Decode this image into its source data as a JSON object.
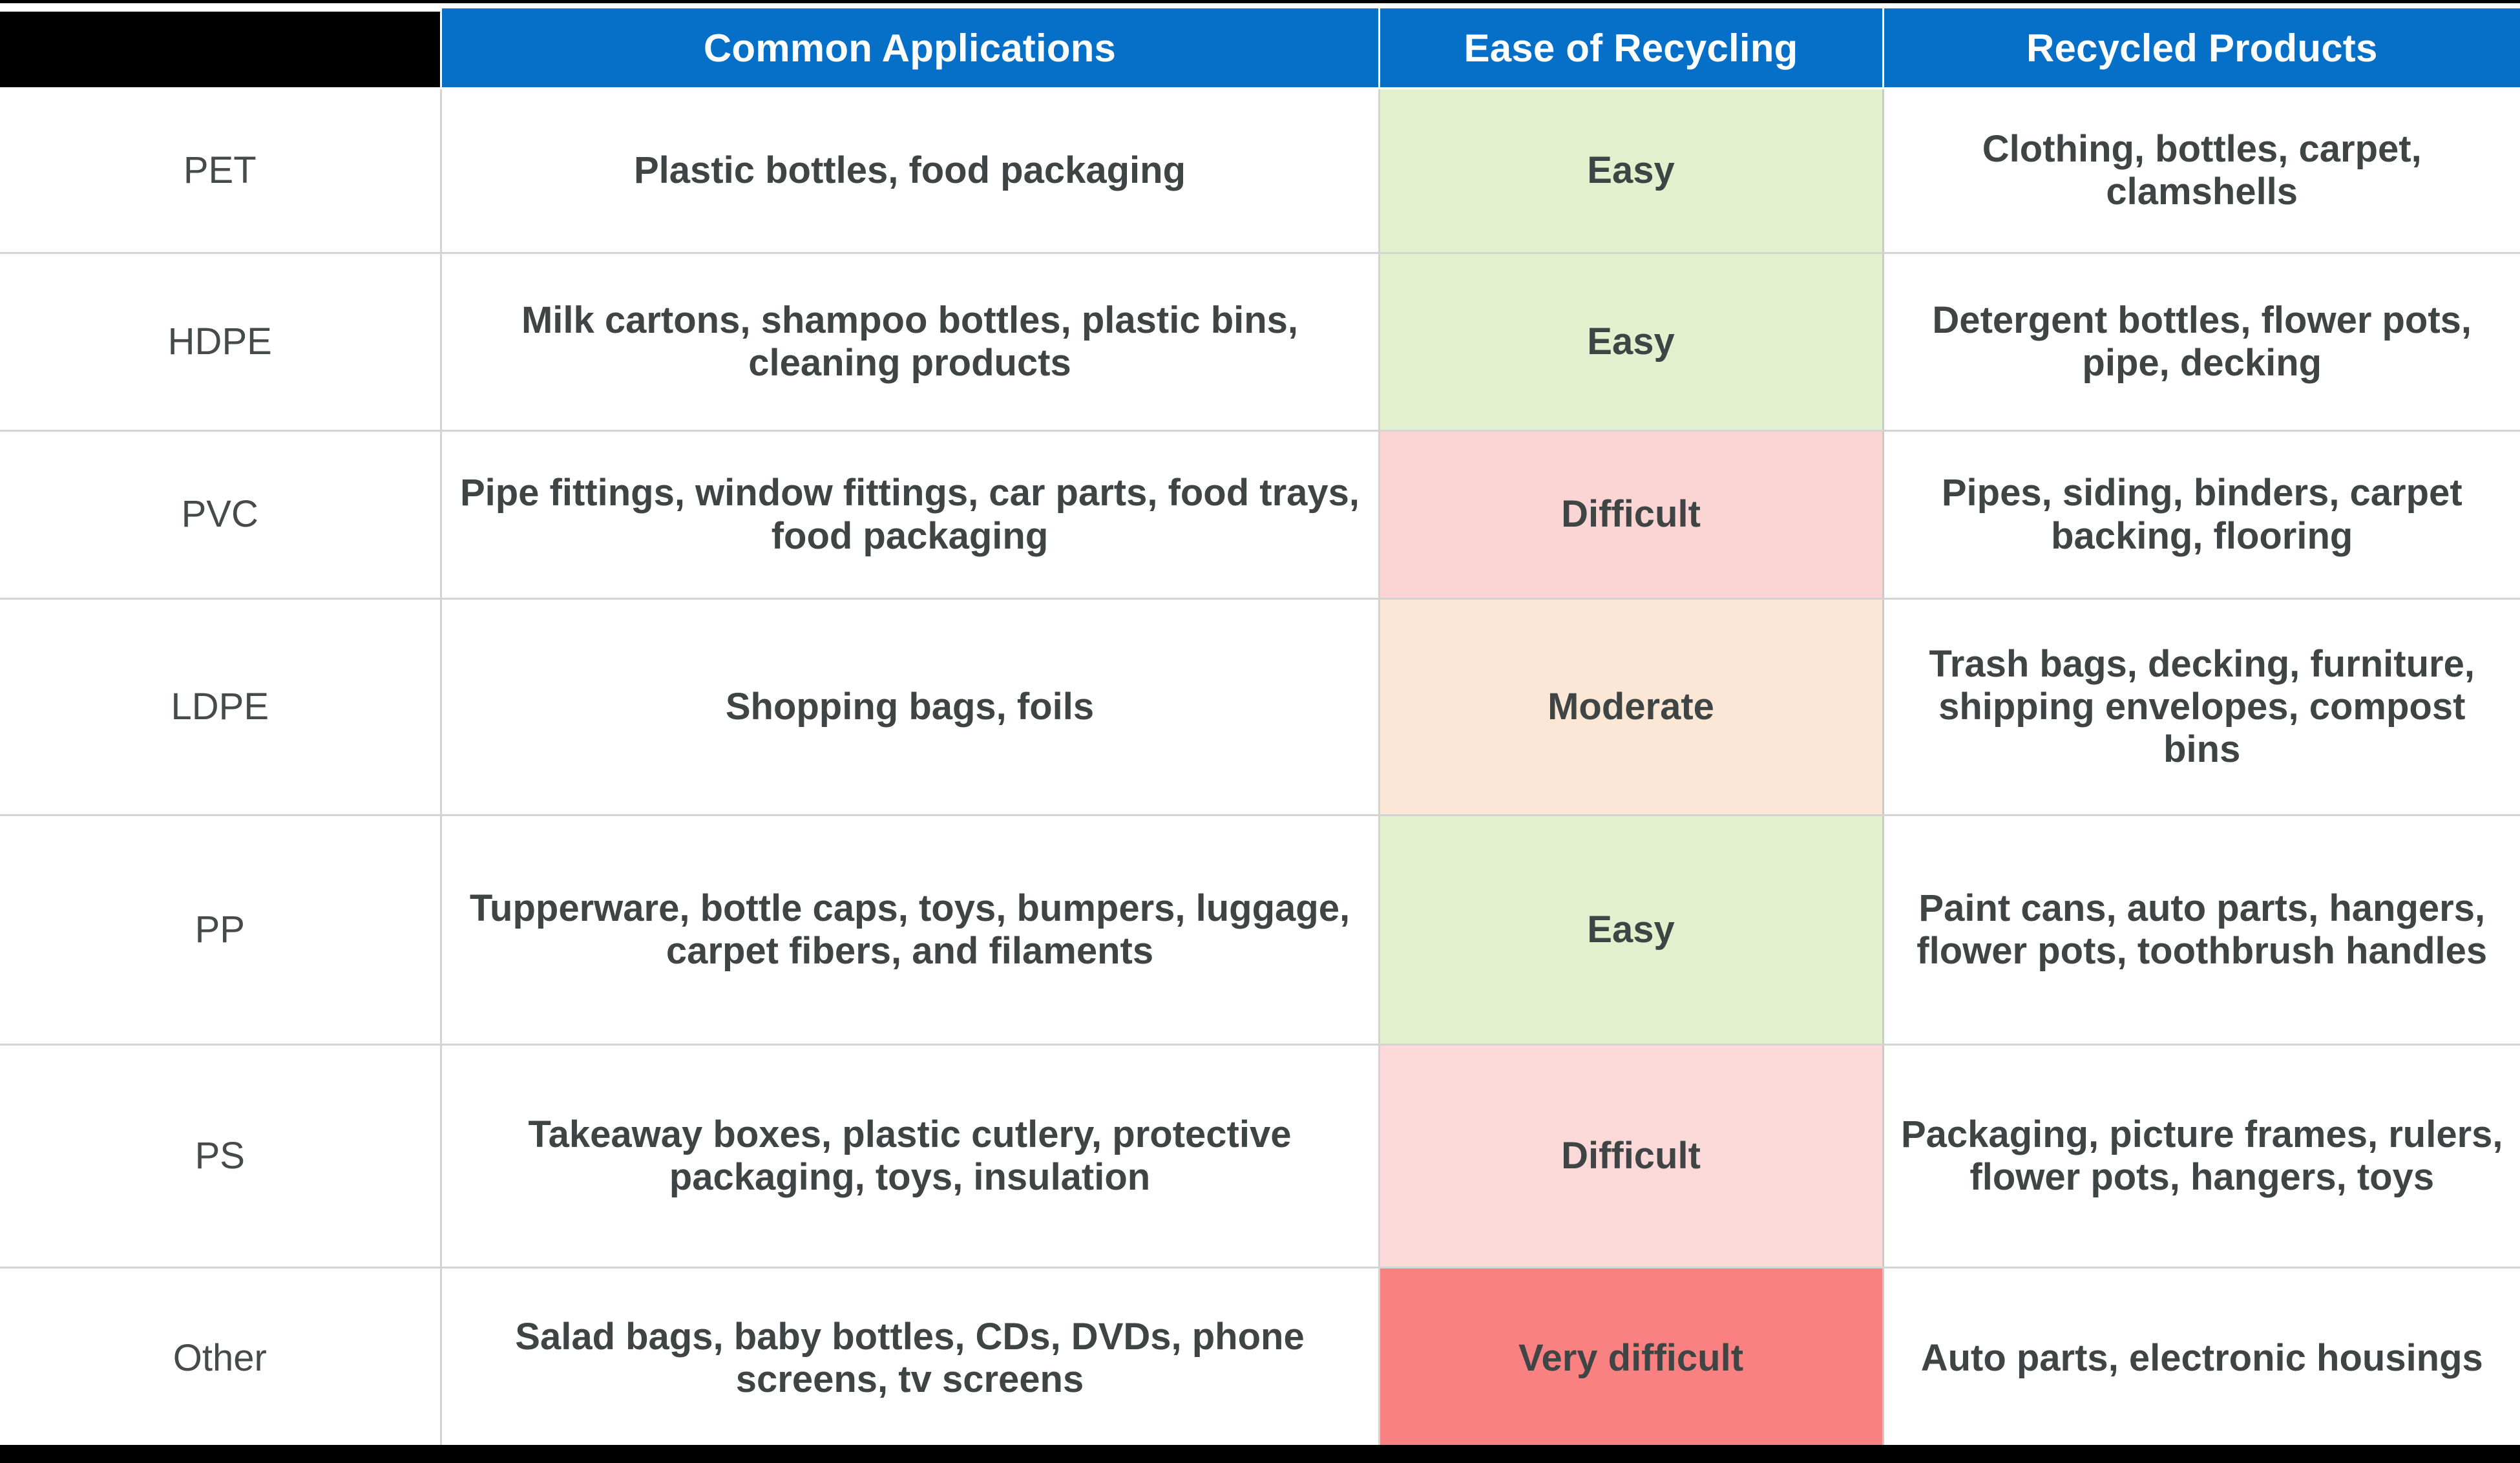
{
  "table": {
    "headers": [
      {
        "label": "",
        "name": "header-plastic-code",
        "style": "black"
      },
      {
        "label": "Common Applications",
        "name": "header-common-applications",
        "style": "blue"
      },
      {
        "label": "Ease of Recycling",
        "name": "header-ease-of-recycling",
        "style": "blue"
      },
      {
        "label": "Recycled Products",
        "name": "header-recycled-products",
        "style": "blue"
      }
    ],
    "colors": {
      "header_blue": "#0670C8",
      "header_black": "#000000",
      "header_text": "#FFFFFF",
      "body_text": "#3F4444",
      "grid_line": "#D4D4D4",
      "ease_easy": "#E2F0CE",
      "ease_moderate": "#FBE7D5",
      "ease_difficult": "#FBD4D4",
      "ease_difficult_light": "#FCD9D9",
      "ease_very_difficult": "#FA8181"
    },
    "rows": [
      {
        "code": "PET",
        "applications": "Plastic bottles, food packaging",
        "ease": "Easy",
        "ease_color": "#E2F0CE",
        "products": "Clothing, bottles, carpet, clamshells"
      },
      {
        "code": "HDPE",
        "applications": "Milk cartons, shampoo bottles, plastic bins, cleaning products",
        "ease": "Easy",
        "ease_color": "#E2F0CE",
        "products": "Detergent bottles, flower pots, pipe, decking"
      },
      {
        "code": "PVC",
        "applications": "Pipe fittings, window fittings, car parts, food trays, food packaging",
        "ease": "Difficult",
        "ease_color": "#FBD4D4",
        "products": "Pipes, siding, binders, carpet backing, flooring"
      },
      {
        "code": "LDPE",
        "applications": "Shopping bags, foils",
        "ease": "Moderate",
        "ease_color": "#FBE7D5",
        "products": "Trash bags, decking, furniture, shipping envelopes, compost bins"
      },
      {
        "code": "PP",
        "applications": "Tupperware, bottle caps, toys, bumpers, luggage, carpet fibers, and filaments",
        "ease": "Easy",
        "ease_color": "#E2F0CE",
        "products": "Paint cans, auto parts, hangers, flower pots, toothbrush handles"
      },
      {
        "code": "PS",
        "applications": "Takeaway boxes, plastic cutlery, protective packaging, toys, insulation",
        "ease": "Difficult",
        "ease_color": "#FCD9D9",
        "products": "Packaging, picture frames, rulers, flower pots, hangers, toys"
      },
      {
        "code": "Other",
        "applications": "Salad bags, baby bottles, CDs, DVDs, phone screens, tv screens",
        "ease": "Very difficult",
        "ease_color": "#FA8181",
        "products": "Auto parts, electronic housings"
      }
    ]
  }
}
